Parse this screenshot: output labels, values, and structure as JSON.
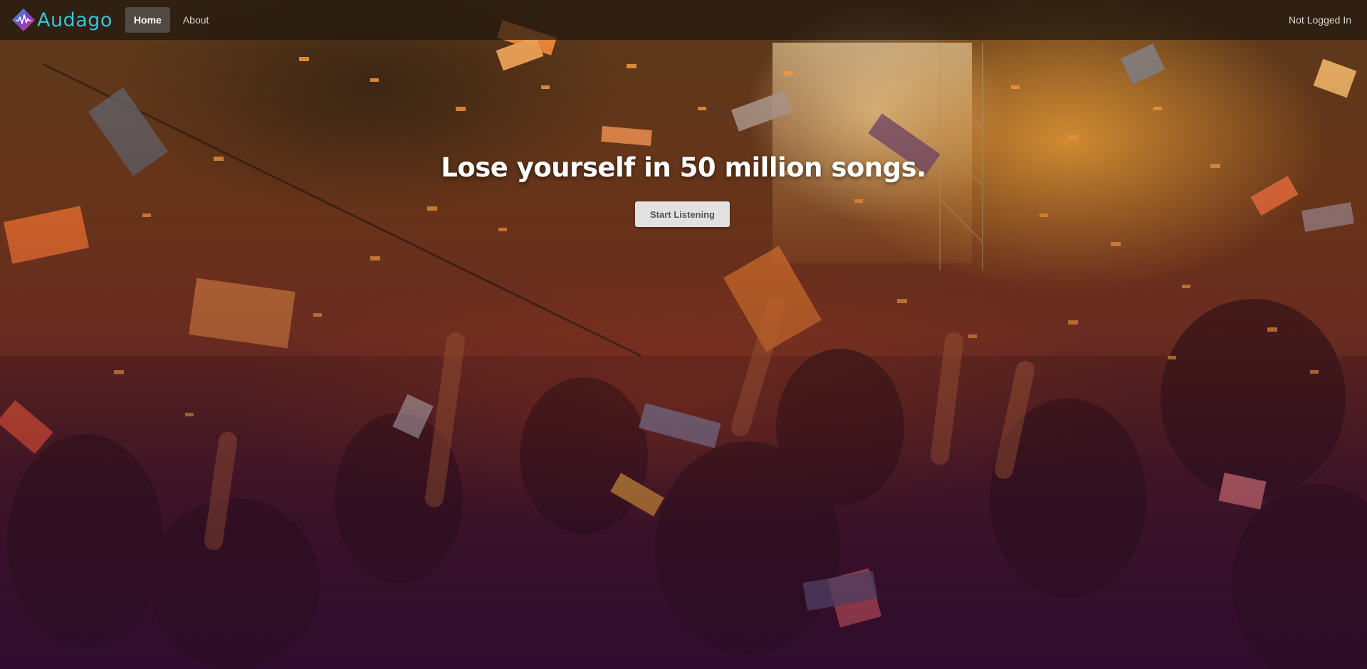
{
  "navbar": {
    "brand_name": "Audago",
    "items": [
      {
        "label": "Home",
        "active": true
      },
      {
        "label": "About",
        "active": false
      }
    ],
    "user_status": "Not Logged In"
  },
  "hero": {
    "title": "Lose yourself in 50 million songs.",
    "cta_label": "Start Listening",
    "background_image": "concert-crowd-with-confetti"
  },
  "colors": {
    "brand_text": "#35c6d8",
    "logo_gradient": [
      "#e0407f",
      "#7b3fc9",
      "#2bb6d6"
    ],
    "button_bg": "#e1e1e1",
    "overlay_top": "#f28a1e",
    "overlay_bottom": "#3c1238"
  }
}
